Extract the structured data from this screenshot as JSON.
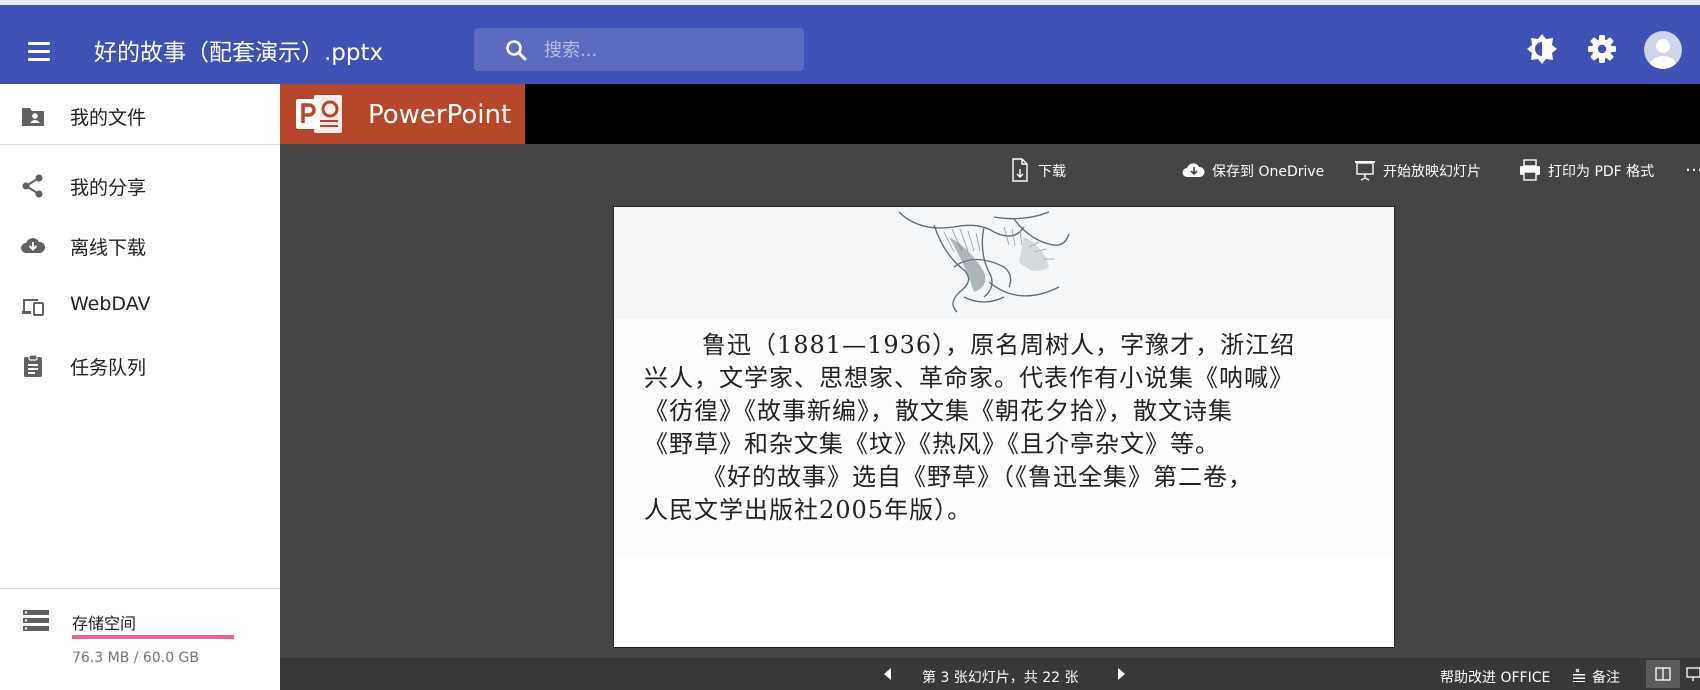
{
  "app": {
    "title": "好的故事（配套演示）.pptx",
    "search_placeholder": "搜索...",
    "accent_color": "#3f51b5"
  },
  "header_icons": [
    "menu-icon",
    "search-icon",
    "brightness-icon",
    "gear-icon",
    "account-icon"
  ],
  "sidebar": {
    "items": [
      {
        "label": "我的文件",
        "icon": "folder-user-icon"
      },
      {
        "label": "我的分享",
        "icon": "share-icon"
      },
      {
        "label": "离线下载",
        "icon": "cloud-download-icon"
      },
      {
        "label": "WebDAV",
        "icon": "devices-icon"
      },
      {
        "label": "任务队列",
        "icon": "clipboard-icon"
      }
    ],
    "storage": {
      "label": "存储空间",
      "usage": "76.3 MB / 60.0 GB",
      "fraction_used": 0.0012
    }
  },
  "viewer": {
    "brand": "PowerPoint",
    "brand_color": "#b7472a",
    "toolbar": {
      "download": "下载",
      "save_onedrive": "保存到 OneDrive",
      "start_slideshow": "开始放映幻灯片",
      "print_pdf": "打印为 PDF 格式",
      "more": "…"
    },
    "slide": {
      "paragraph1_lines": [
        "鲁迅（1881—1936），原名周树人，字豫才，浙江绍",
        "兴人，文学家、思想家、革命家。代表作有小说集《呐喊》",
        "《彷徨》《故事新编》，散文集《朝花夕拾》，散文诗集",
        "《野草》和杂文集《坟》《热风》《且介亭杂文》等。"
      ],
      "paragraph2_lines": [
        "《好的故事》选自《野草》（《鲁迅全集》第二卷，",
        "人民文学出版社2005年版）。"
      ]
    },
    "status": {
      "slide_counter": "第 3 张幻灯片，共 22 张",
      "help_improve": "帮助改进 OFFICE",
      "notes": "备注"
    }
  }
}
